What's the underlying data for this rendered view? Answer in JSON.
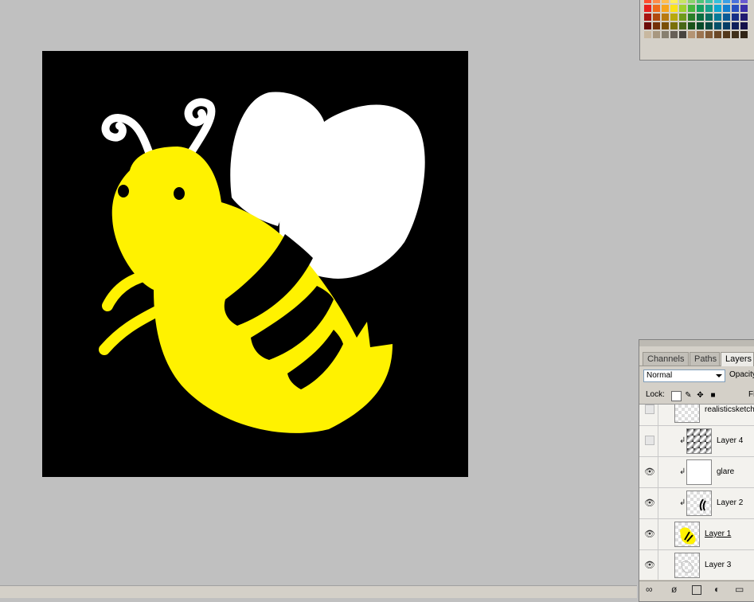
{
  "canvas": {
    "background": "#000000",
    "artwork": "cartoon bee",
    "colors": {
      "body": "#fff200",
      "wing": "#ffffff",
      "stripe": "#000000"
    }
  },
  "swatches": {
    "rows": [
      [
        "#ff4e2e",
        "#ff8b4a",
        "#ffbe4e",
        "#fff05a",
        "#c8e464",
        "#8ad26c",
        "#4fc47a",
        "#3cc3a8",
        "#35bfdc",
        "#3aa0e6",
        "#4a72dc",
        "#6a5ad0"
      ],
      [
        "#e8201c",
        "#f06a1c",
        "#f7a51c",
        "#fbe21a",
        "#9fd02e",
        "#46b63c",
        "#15a060",
        "#16a08e",
        "#0ea6d2",
        "#1480d0",
        "#2a50c0",
        "#3c2ea8"
      ],
      [
        "#a81410",
        "#b04a10",
        "#b87a10",
        "#b8a810",
        "#6f9a1c",
        "#2a7e28",
        "#0c6e40",
        "#0a6e62",
        "#067a98",
        "#0a5a96",
        "#182f86",
        "#221a70"
      ],
      [
        "#6c0c08",
        "#743008",
        "#7a5008",
        "#7a7008",
        "#486616",
        "#1a521a",
        "#084a2a",
        "#064840",
        "#04506a",
        "#063c66",
        "#0e1e5a",
        "#14104a"
      ],
      [
        "#c8b8a0",
        "#a89880",
        "#888070",
        "#686058",
        "#484440",
        "#b49474",
        "#9c7450",
        "#845c38",
        "#6c4828",
        "#54381c",
        "#40301a",
        "#302416"
      ]
    ]
  },
  "layers_panel": {
    "tabs": [
      {
        "label": "Channels",
        "active": false
      },
      {
        "label": "Paths",
        "active": false
      },
      {
        "label": "Layers",
        "active": true
      }
    ],
    "blend_mode": "Normal",
    "opacity_label": "Opacity",
    "lock_label": "Lock:",
    "fill_label": "Fi",
    "layers": [
      {
        "name": "realisticsketch",
        "visible": false,
        "clipped": false,
        "thumb": "checker"
      },
      {
        "name": "Layer 4",
        "visible": false,
        "clipped": true,
        "thumb": "glare-gradient"
      },
      {
        "name": "glare",
        "visible": true,
        "clipped": true,
        "thumb": "white"
      },
      {
        "name": "Layer 2",
        "visible": true,
        "clipped": true,
        "thumb": "stripes"
      },
      {
        "name": "Layer 1",
        "visible": true,
        "clipped": false,
        "thumb": "bee-yellow",
        "active": true
      },
      {
        "name": "Layer 3",
        "visible": true,
        "clipped": false,
        "thumb": "sketch"
      }
    ]
  }
}
